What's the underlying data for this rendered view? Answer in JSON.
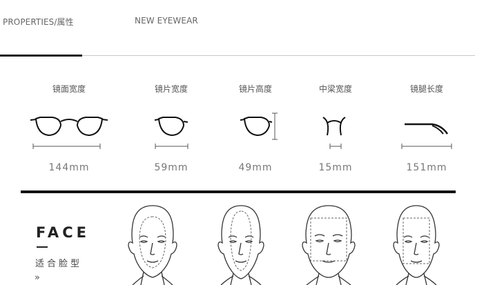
{
  "tabs": [
    {
      "label": "PROPERTIES/属性",
      "active": true
    },
    {
      "label": "NEW EYEWEAR",
      "active": false
    }
  ],
  "specs": [
    {
      "label": "镜面宽度",
      "value": "144mm",
      "icon": "glasses-front-width-icon"
    },
    {
      "label": "镜片宽度",
      "value": "59mm",
      "icon": "lens-width-icon"
    },
    {
      "label": "镜片高度",
      "value": "49mm",
      "icon": "lens-height-icon"
    },
    {
      "label": "中梁宽度",
      "value": "15mm",
      "icon": "bridge-width-icon"
    },
    {
      "label": "镜腿长度",
      "value": "151mm",
      "icon": "temple-length-icon"
    }
  ],
  "face_section": {
    "title": "FACE",
    "subtitle": "适合脸型",
    "arrow": "»",
    "faces": [
      {
        "shape": "oval",
        "icon": "face-oval-icon"
      },
      {
        "shape": "long",
        "icon": "face-long-icon"
      },
      {
        "shape": "square",
        "icon": "face-square-icon"
      },
      {
        "shape": "rectangle",
        "icon": "face-rectangle-icon"
      }
    ]
  },
  "colors": {
    "accent": "#111111",
    "text": "#555555",
    "line": "#c8c8c8"
  }
}
